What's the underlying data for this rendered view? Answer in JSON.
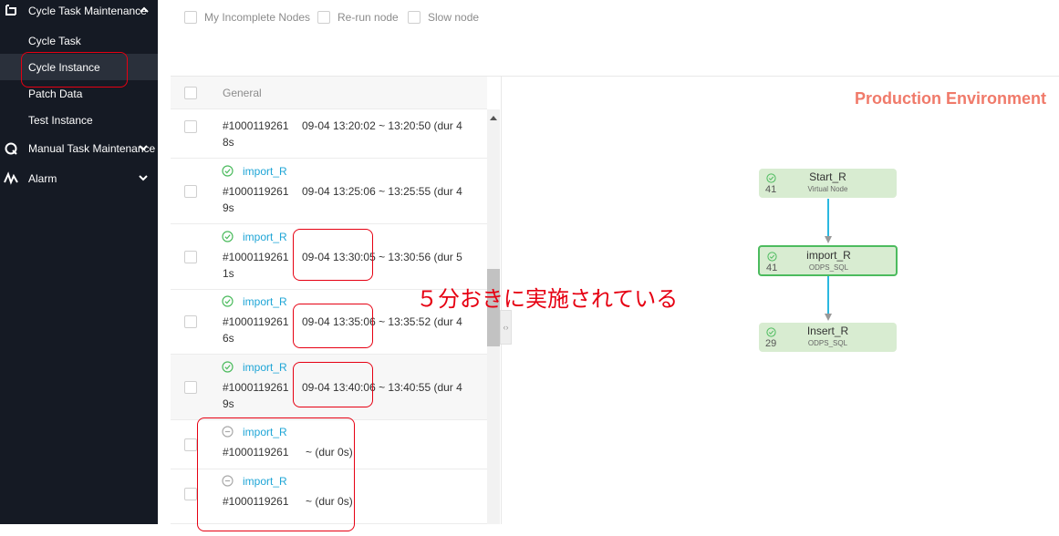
{
  "sidebar": {
    "groups": [
      {
        "label": "Cycle Task Maintenance",
        "icon": "cycle-task-icon",
        "expanded": true
      },
      {
        "label": "Manual Task Maintenance",
        "icon": "manual-task-icon",
        "expanded": false
      },
      {
        "label": "Alarm",
        "icon": "alarm-icon",
        "expanded": false
      }
    ],
    "items": [
      {
        "label": "Cycle Task",
        "active": false
      },
      {
        "label": "Cycle Instance",
        "active": true
      },
      {
        "label": "Patch Data",
        "active": false
      },
      {
        "label": "Test Instance",
        "active": false
      }
    ]
  },
  "filters": [
    {
      "label": "My Incomplete Nodes"
    },
    {
      "label": "Re-run node"
    },
    {
      "label": "Slow node"
    }
  ],
  "list": {
    "header": "General",
    "rows": [
      {
        "name": "",
        "status": "",
        "id": "#1000119261",
        "time": "09-04 13:20:02 ~ 13:20:50 (dur 4",
        "time_cont": "8s"
      },
      {
        "name": "import_R",
        "status": "success",
        "id": "#1000119261",
        "time": "09-04 13:25:06 ~ 13:25:55 (dur 4",
        "time_cont": "9s"
      },
      {
        "name": "import_R",
        "status": "success",
        "id": "#1000119261",
        "time": "09-04 13:30:05 ~ 13:30:56 (dur 5",
        "time_cont": "1s"
      },
      {
        "name": "import_R",
        "status": "success",
        "id": "#1000119261",
        "time": "09-04 13:35:06 ~ 13:35:52 (dur 4",
        "time_cont": "6s"
      },
      {
        "name": "import_R",
        "status": "success",
        "id": "#1000119261",
        "time": "09-04 13:40:06 ~ 13:40:55 (dur 4",
        "time_cont": "9s"
      },
      {
        "name": "import_R",
        "status": "pending",
        "id": "#1000119261",
        "time": "~ (dur 0s)",
        "time_cont": ""
      },
      {
        "name": "import_R",
        "status": "pending",
        "id": "#1000119261",
        "time": "~ (dur 0s)",
        "time_cont": ""
      }
    ]
  },
  "graph": {
    "environment": "Production Environment",
    "nodes": [
      {
        "title": "Start_R",
        "type": "Virtual Node",
        "count": "41",
        "selected": false
      },
      {
        "title": "import_R",
        "type": "ODPS_SQL",
        "count": "41",
        "selected": true
      },
      {
        "title": "Insert_R",
        "type": "ODPS_SQL",
        "count": "29",
        "selected": false
      }
    ]
  },
  "annotation": {
    "text": "５分おきに実施されている"
  },
  "colors": {
    "sidebar_bg": "#151a24",
    "link": "#1ea5d6",
    "success": "#4cbb5e",
    "env_label": "#f07a6a",
    "annotation": "#e60012",
    "node_bg": "#d8ecd1"
  }
}
